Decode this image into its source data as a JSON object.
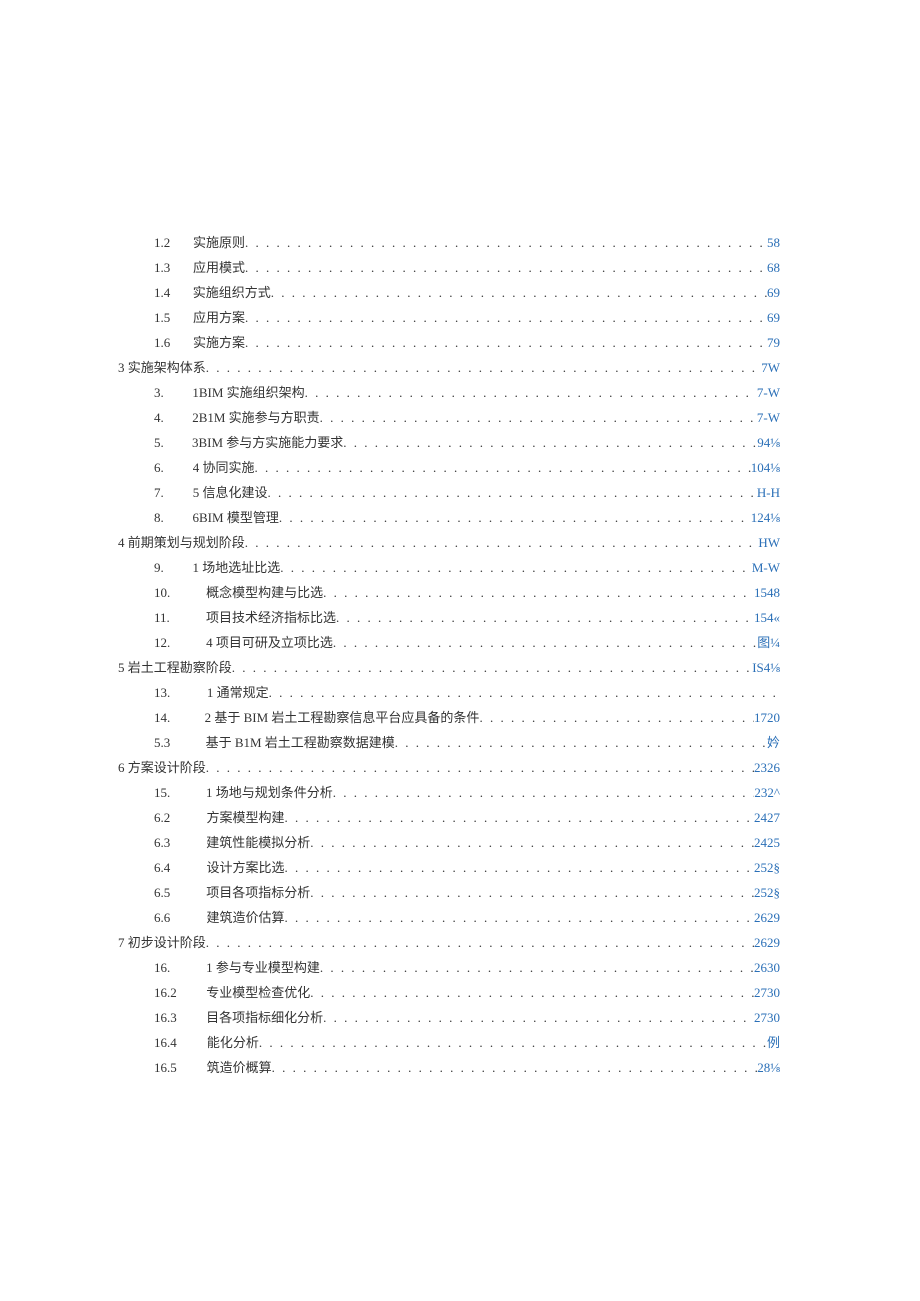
{
  "toc": [
    {
      "indent": "i1",
      "num": "1.2",
      "label": "实施原则",
      "page": "58"
    },
    {
      "indent": "i1",
      "num": "1.3",
      "label": "应用模式",
      "page": "68"
    },
    {
      "indent": "i1",
      "num": "1.4",
      "label": "实施组织方式",
      "page": "69"
    },
    {
      "indent": "i1",
      "num": "1.5",
      "label": "应用方案",
      "page": "69"
    },
    {
      "indent": "i1",
      "num": "1.6",
      "label": "实施方案",
      "page": "79"
    },
    {
      "indent": "i0",
      "num": "",
      "label": "3 实施架构体系 ",
      "page": "7W"
    },
    {
      "indent": "i1",
      "num": "3.",
      "label": "1BIM 实施组织架构 ",
      "page": "7-W"
    },
    {
      "indent": "i1",
      "num": "4.",
      "label": "2B1M 实施参与方职责 ",
      "page": "7-W"
    },
    {
      "indent": "i1",
      "num": "5.",
      "label": "3BIM 参与方实施能力要求 ",
      "page": "94⅛"
    },
    {
      "indent": "i1",
      "num": "6.",
      "label": "4 协同实施 ",
      "page": "104⅛"
    },
    {
      "indent": "i1",
      "num": "7.",
      "label": "5 信息化建设 ",
      "page": "H-H"
    },
    {
      "indent": "i1",
      "num": "8.",
      "label": "6BIM 模型管理 ",
      "page": "124⅛"
    },
    {
      "indent": "i0",
      "num": "",
      "label": "4 前期策划与规划阶段 ",
      "page": "HW"
    },
    {
      "indent": "i1",
      "num": "9.",
      "label": "1 场地选址比选 ",
      "page": "M-W"
    },
    {
      "indent": "i1b",
      "num": "10.",
      "label": "概念模型构建与比选",
      "page": "1548"
    },
    {
      "indent": "i1b",
      "num": "11.",
      "label": "项目技术经济指标比选",
      "page": "154«"
    },
    {
      "indent": "i1b",
      "num": "12.",
      "label": "4 项目可研及立项比选 ",
      "page": "图¼"
    },
    {
      "indent": "i0",
      "num": "",
      "label": "5 岩土工程勘察阶段",
      "page": "IS4⅛"
    },
    {
      "indent": "i1b",
      "num": "13.",
      "label": "1 通常规定 ",
      "page": "",
      "nopage": true
    },
    {
      "indent": "i1b",
      "num": "14.",
      "label": "2 基于 BIM 岩土工程勘察信息平台应具备的条件 ",
      "page": "1720"
    },
    {
      "indent": "i2",
      "num": "5.3",
      "label": "基于 B1M 岩土工程勘察数据建模 ",
      "page": "妗"
    },
    {
      "indent": "i0",
      "num": "",
      "label": "6 方案设计阶段 ",
      "page": "2326"
    },
    {
      "indent": "i1b",
      "num": "15.",
      "label": "1 场地与规划条件分析 ",
      "page": "232^"
    },
    {
      "indent": "i2",
      "num": "6.2",
      "label": "方案模型构建 ",
      "page": "2427"
    },
    {
      "indent": "i2",
      "num": "6.3",
      "label": "建筑性能模拟分析 ",
      "page": "2425"
    },
    {
      "indent": "i2",
      "num": "6.4",
      "label": "设计方案比选 ",
      "page": "252§"
    },
    {
      "indent": "i2",
      "num": "6.5",
      "label": "项目各项指标分析 ",
      "page": "252§"
    },
    {
      "indent": "i2",
      "num": "6.6",
      "label": "建筑造价估算 ",
      "page": "2629"
    },
    {
      "indent": "i0",
      "num": "",
      "label": "7 初步设计阶段 ",
      "page": "2629"
    },
    {
      "indent": "i1b",
      "num": "16.",
      "label": "1 参与专业模型构建 ",
      "page": "2630"
    },
    {
      "indent": "i2",
      "num": "16.2",
      "label": "专业模型检查优化",
      "page": "2730"
    },
    {
      "indent": "i2",
      "num": "16.3",
      "label": "目各项指标细化分析",
      "page": "2730"
    },
    {
      "indent": "i2",
      "num": "16.4",
      "label": "能化分析",
      "page": "例"
    },
    {
      "indent": "i2",
      "num": "16.5",
      "label": "筑造价概算",
      "page": "28⅛"
    }
  ]
}
